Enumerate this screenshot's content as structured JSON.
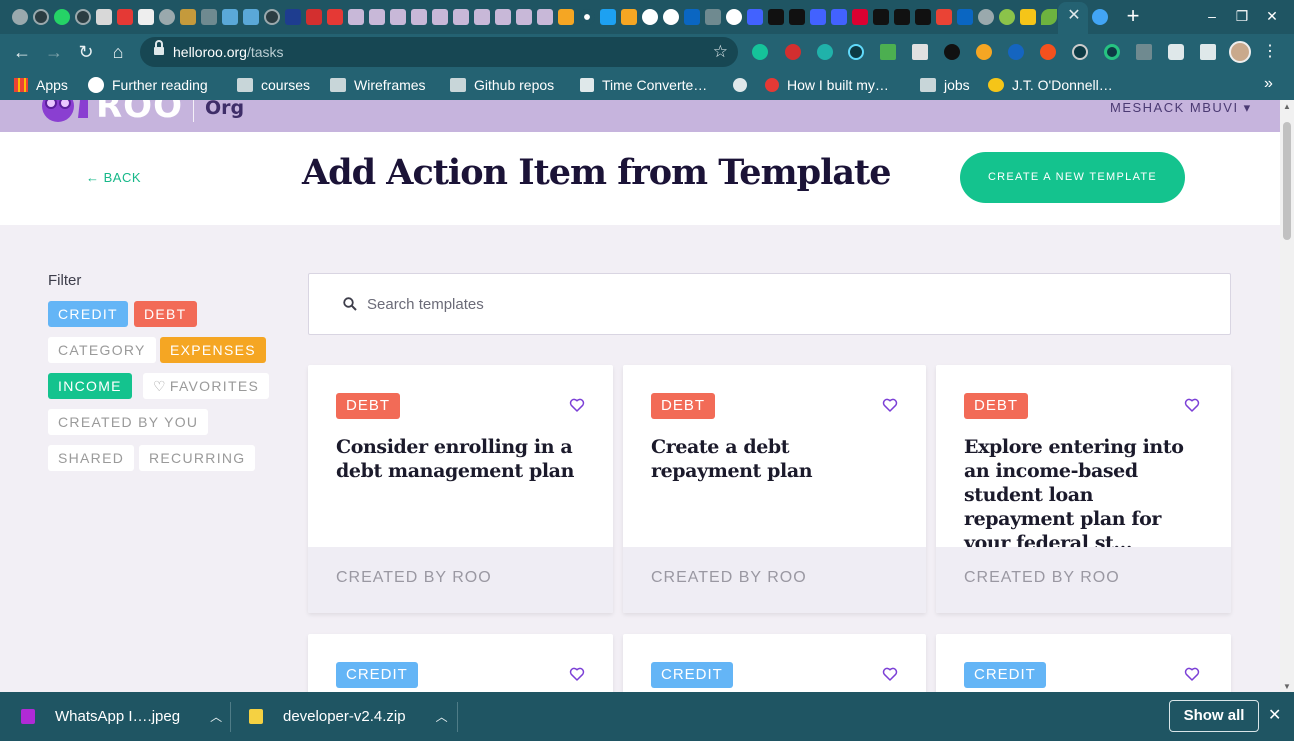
{
  "browser": {
    "url_host": "helloroo.org",
    "url_path": "/tasks",
    "bookmarks": [
      "Apps",
      "Further reading",
      "courses",
      "Wireframes",
      "Github repos",
      "Time Converte…",
      "How I built my…",
      "jobs",
      "J.T. O'Donnell…"
    ],
    "bookmarks_overflow": "»"
  },
  "site": {
    "logo_text": "ROO",
    "logo_suffix": "Org",
    "user_menu": "MESHACK MBUVI ▾"
  },
  "header": {
    "back_label": "← BACK",
    "title": "Add Action Item from Template",
    "create_button": "CREATE A NEW TEMPLATE"
  },
  "filters": {
    "label": "Filter",
    "chips": [
      "CREDIT",
      "DEBT",
      "CATEGORY",
      "EXPENSES",
      "INCOME",
      "FAVORITES",
      "CREATED BY YOU",
      "SHARED",
      "RECURRING"
    ]
  },
  "search": {
    "placeholder": "Search templates"
  },
  "cards": [
    {
      "tag": "DEBT",
      "title": "Consider enrolling in a debt management plan",
      "creator": "CREATED BY ROO"
    },
    {
      "tag": "DEBT",
      "title": "Create a debt repayment plan",
      "creator": "CREATED BY ROO"
    },
    {
      "tag": "DEBT",
      "title": "Explore entering into an income-based student loan repayment plan for your federal st...",
      "creator": "CREATED BY ROO"
    },
    {
      "tag": "CREDIT"
    },
    {
      "tag": "CREDIT"
    },
    {
      "tag": "CREDIT"
    }
  ],
  "downloads": {
    "items": [
      "WhatsApp I….jpeg",
      "developer-v2.4.zip"
    ],
    "show_all": "Show all"
  },
  "colors": {
    "brand_green": "#14c38e",
    "brand_purple": "#c6b4dd",
    "debt_red": "#f26b57",
    "credit_blue": "#64b5f6",
    "expenses_orange": "#f5a623",
    "browser_teal": "#246272"
  }
}
